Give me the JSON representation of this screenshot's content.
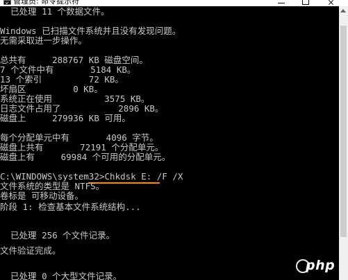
{
  "window": {
    "title": "管理员: 命令提示符"
  },
  "console": {
    "lines": [
      "  已处理 11 个数据文件。",
      "",
      "Windows 已扫描文件系统并且没有发现问题。",
      "无需采取进一步操作。",
      "",
      "总共有     288767 KB 磁盘空间。",
      "7 个文件中有       5184 KB。",
      "13 个索引         72 KB。",
      "坏扇区         0 KB。",
      "系统正在使用          3575 KB。",
      "日志文件占用了           2896 KB。",
      "磁盘上     279936 KB 可用。",
      "",
      "每个分配单元中有       4096 字节。",
      "磁盘上共有       72191 个分配单元。",
      "磁盘上有     69984 个可用的分配单元。",
      "",
      "C:\\WINDOWS\\system32>Chkdsk E: /F /X",
      "文件系统的类型是 NTFS。",
      "卷标是 可移动设备。",
      "",
      "阶段 1: 检查基本文件系统结构...",
      "",
      "",
      "  已处理 256 个文件记录。",
      "",
      "文件验证完成。",
      "",
      "",
      "  已处理 0 个大型文件记录。"
    ]
  },
  "colors": {
    "console_background": "#000000",
    "console_text": "#c8c8c8",
    "command_underline": "#ff8a00",
    "titlebar": "#ffffff"
  },
  "watermark": {
    "text": "php"
  }
}
